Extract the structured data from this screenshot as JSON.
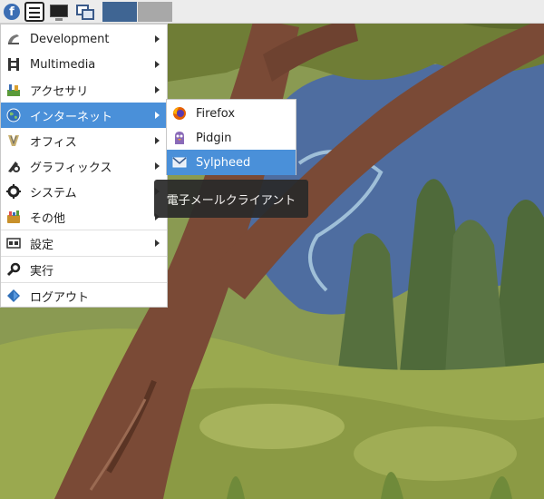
{
  "colors": {
    "accent": "#4a90d9",
    "panel_bg": "#ececec",
    "workspace_active": "#3f6593",
    "workspace_inactive": "#a8a8a8",
    "tooltip_bg": "#2a2a2a"
  },
  "panel": {
    "start_icon": "fedora-logo-icon",
    "start_glyph": "f",
    "launchers": [
      "file-manager-icon",
      "terminal-icon",
      "window-switcher-icon"
    ],
    "workspaces": [
      "workspace-1",
      "workspace-2"
    ]
  },
  "main_menu": {
    "items": [
      {
        "label": "Development",
        "icon": "development-icon",
        "submenu": true
      },
      {
        "label": "Multimedia",
        "icon": "multimedia-icon",
        "submenu": true
      },
      {
        "label": "アクセサリ",
        "icon": "accessories-icon",
        "submenu": true
      },
      {
        "label": "インターネット",
        "icon": "internet-globe-icon",
        "submenu": true,
        "active": true
      },
      {
        "label": "オフィス",
        "icon": "office-icon",
        "submenu": true
      },
      {
        "label": "グラフィックス",
        "icon": "graphics-icon",
        "submenu": true
      },
      {
        "label": "システム",
        "icon": "system-gear-icon",
        "submenu": true
      },
      {
        "label": "その他",
        "icon": "other-icon",
        "submenu": true
      },
      {
        "label": "設定",
        "icon": "settings-icon",
        "submenu": true
      },
      {
        "label": "実行",
        "icon": "run-icon",
        "submenu": false
      },
      {
        "label": "ログアウト",
        "icon": "logout-icon",
        "submenu": false
      }
    ]
  },
  "internet_submenu": {
    "items": [
      {
        "label": "Firefox",
        "icon": "firefox-icon"
      },
      {
        "label": "Pidgin",
        "icon": "pidgin-icon"
      },
      {
        "label": "Sylpheed",
        "icon": "sylpheed-icon",
        "active": true
      }
    ]
  },
  "tooltip": {
    "text": "電子メールクライアント"
  }
}
